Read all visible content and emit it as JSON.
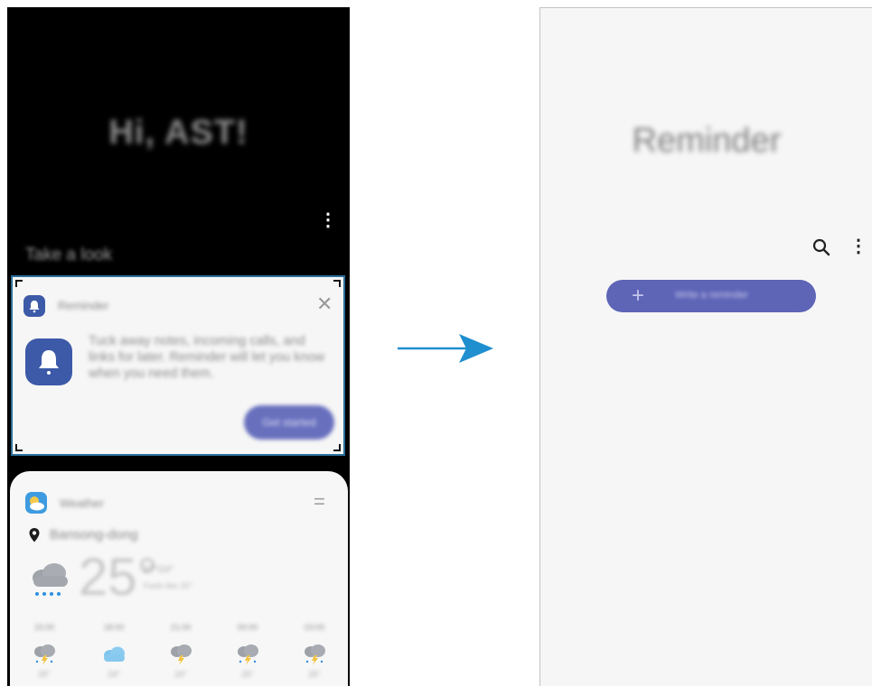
{
  "left_panel": {
    "greeting": "Hi, AST!",
    "menu_glyph": "⋮",
    "take_a_look": "Take a look",
    "reminder_card": {
      "app_name": "Reminder",
      "close_glyph": "✕",
      "description": "Tuck away notes, incoming calls, and links for later. Reminder will let you know when you need them.",
      "cta_label": "Get started"
    },
    "weather_card": {
      "app_name": "Weather",
      "menu_glyph": "=",
      "location": "Bansong-dong",
      "temperature": "25°",
      "range": "27°/24°",
      "feels_like": "Feels like 25°",
      "hourly": [
        {
          "time": "15:00",
          "icon": "rain-thunder-icon",
          "temp": "25°"
        },
        {
          "time": "18:00",
          "icon": "cloud-icon",
          "temp": "24°"
        },
        {
          "time": "21:00",
          "icon": "thunder-cloud-icon",
          "temp": "24°"
        },
        {
          "time": "00:00",
          "icon": "rain-thunder-icon",
          "temp": "25°"
        },
        {
          "time": "03:00",
          "icon": "rain-thunder-icon",
          "temp": "25°"
        }
      ]
    }
  },
  "right_panel": {
    "title": "Reminder",
    "menu_glyph": "⋮",
    "write_button_plus": "+",
    "write_button_label": "Write a reminder"
  },
  "colors": {
    "frame_highlight": "#2b6f9a",
    "reminder_accent": "#3d5aa8",
    "button_purple": "#6870be",
    "arrow_blue": "#1f8fd0"
  }
}
